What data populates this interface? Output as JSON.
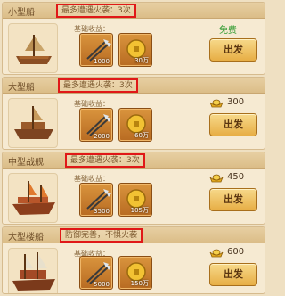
{
  "cards": [
    {
      "name": "小型船",
      "tag": "最多遭遇火袭：3次",
      "income_label": "基础收益：",
      "items": [
        {
          "count": "1000"
        },
        {
          "count": "30万"
        }
      ],
      "price": "免费",
      "free": true,
      "button": "出发"
    },
    {
      "name": "大型船",
      "tag": "最多遭遇火袭：3次",
      "income_label": "基础收益：",
      "items": [
        {
          "count": "2000"
        },
        {
          "count": "60万"
        }
      ],
      "price": "300",
      "free": false,
      "button": "出发"
    },
    {
      "name": "中型战舰",
      "tag": "最多遭遇火袭：3次",
      "income_label": "基础收益：",
      "items": [
        {
          "count": "3500"
        },
        {
          "count": "105万"
        }
      ],
      "price": "450",
      "free": false,
      "button": "出发"
    },
    {
      "name": "大型楼船",
      "tag": "防御完善，不惧火袭",
      "income_label": "基础收益：",
      "items": [
        {
          "count": "5000"
        },
        {
          "count": "150万"
        }
      ],
      "price": "600",
      "free": false,
      "button": "出发"
    }
  ],
  "colors": {
    "highlight_border": "#e01818",
    "free_text": "#2f9a2f",
    "button": "#e7ae45"
  },
  "icons": {
    "ship": "ship-icon",
    "arrows": "arrows-icon",
    "coin": "gold-coin-icon",
    "ingot": "gold-ingot-icon"
  }
}
